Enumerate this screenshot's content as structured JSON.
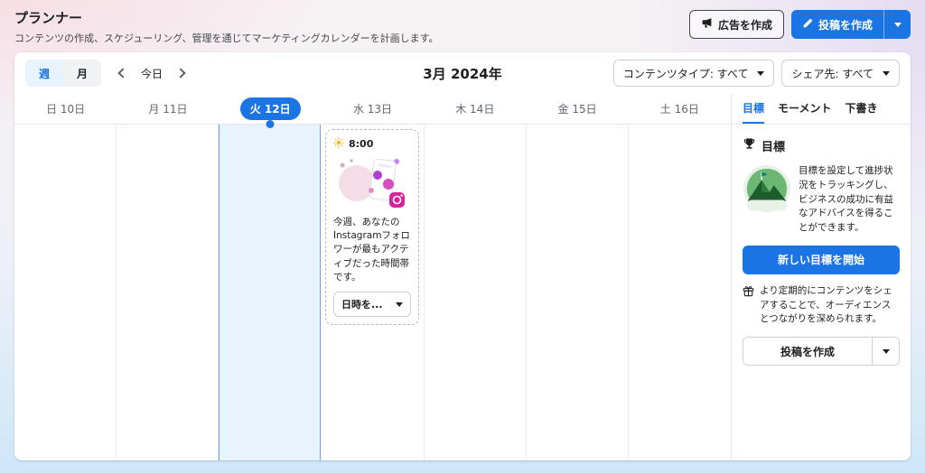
{
  "page": {
    "title": "プランナー",
    "subtitle": "コンテンツの作成、スケジューリング、管理を通じてマーケティングカレンダーを計画します。"
  },
  "header": {
    "create_ad_label": "広告を作成",
    "create_post_label": "投稿を作成"
  },
  "toolbar": {
    "week_label": "週",
    "month_label": "月",
    "today_label": "今日",
    "month_title": "3月 2024年",
    "content_type_filter": "コンテンツタイプ: すべて",
    "share_target_filter": "シェア先: すべて"
  },
  "calendar": {
    "day_headers": [
      "日 10日",
      "月 11日",
      "火 12日",
      "水 13日",
      "木 14日",
      "金 15日",
      "土 16日"
    ],
    "active_day": "火 12日",
    "suggestion_card": {
      "time": "8:00",
      "message": "今週、あなたのInstagramフォロワーが最もアクティブだった時間帯です。",
      "datetime_dropdown_label": "日時を..."
    }
  },
  "sidebar": {
    "tabs": [
      "目標",
      "モーメント",
      "下書き"
    ],
    "goals": {
      "heading": "目標",
      "description": "目標を設定して進捗状況をトラッキングし、ビジネスの成功に有益なアドバイスを得ることができます。",
      "start_goal_button": "新しい目標を開始",
      "tip": "より定期的にコンテンツをシェアすることで、オーディエンスとつながりを深められます。",
      "create_post_button": "投稿を作成"
    }
  },
  "colors": {
    "accent_blue": "#1b74e4",
    "active_day_bg": "#e8f3fd",
    "goal_green": "#2f9e44"
  }
}
